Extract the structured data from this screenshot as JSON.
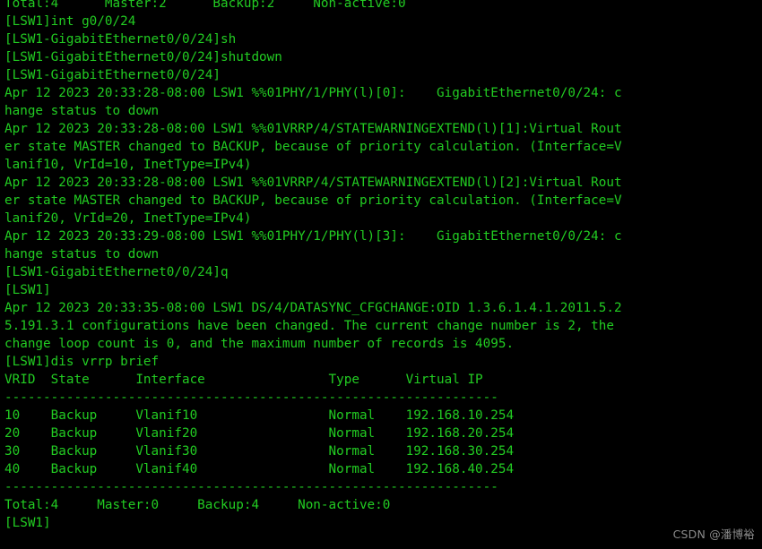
{
  "terminal": {
    "device_name": "LSW1",
    "colors": {
      "background": "#000000",
      "foreground": "#22cc22",
      "watermark": "#8a8a8a"
    },
    "lines": [
      "Total:4      Master:2      Backup:2     Non-active:0",
      "[LSW1]int g0/0/24",
      "[LSW1-GigabitEthernet0/0/24]sh",
      "[LSW1-GigabitEthernet0/0/24]shutdown",
      "[LSW1-GigabitEthernet0/0/24]",
      "Apr 12 2023 20:33:28-08:00 LSW1 %%01PHY/1/PHY(l)[0]:    GigabitEthernet0/0/24: c",
      "hange status to down",
      "Apr 12 2023 20:33:28-08:00 LSW1 %%01VRRP/4/STATEWARNINGEXTEND(l)[1]:Virtual Rout",
      "er state MASTER changed to BACKUP, because of priority calculation. (Interface=V",
      "lanif10, VrId=10, InetType=IPv4)",
      "Apr 12 2023 20:33:28-08:00 LSW1 %%01VRRP/4/STATEWARNINGEXTEND(l)[2]:Virtual Rout",
      "er state MASTER changed to BACKUP, because of priority calculation. (Interface=V",
      "lanif20, VrId=20, InetType=IPv4)",
      "Apr 12 2023 20:33:29-08:00 LSW1 %%01PHY/1/PHY(l)[3]:    GigabitEthernet0/0/24: c",
      "hange status to down",
      "[LSW1-GigabitEthernet0/0/24]q",
      "[LSW1]",
      "Apr 12 2023 20:33:35-08:00 LSW1 DS/4/DATASYNC_CFGCHANGE:OID 1.3.6.1.4.1.2011.5.2",
      "5.191.3.1 configurations have been changed. The current change number is 2, the",
      "change loop count is 0, and the maximum number of records is 4095.",
      "[LSW1]dis vrrp brief",
      "VRID  State      Interface                Type      Virtual IP",
      "----------------------------------------------------------------",
      "10    Backup     Vlanif10                 Normal    192.168.10.254",
      "20    Backup     Vlanif20                 Normal    192.168.20.254",
      "30    Backup     Vlanif30                 Normal    192.168.30.254",
      "40    Backup     Vlanif40                 Normal    192.168.40.254",
      "----------------------------------------------------------------",
      "Total:4     Master:0     Backup:4     Non-active:0",
      "[LSW1]"
    ],
    "commands_entered": [
      "int g0/0/24",
      "sh",
      "shutdown",
      "q",
      "dis vrrp brief"
    ],
    "vrrp_table": {
      "headers": [
        "VRID",
        "State",
        "Interface",
        "Type",
        "Virtual IP"
      ],
      "rows": [
        {
          "vrid": "10",
          "state": "Backup",
          "interface": "Vlanif10",
          "type": "Normal",
          "virtual_ip": "192.168.10.254"
        },
        {
          "vrid": "20",
          "state": "Backup",
          "interface": "Vlanif20",
          "type": "Normal",
          "virtual_ip": "192.168.20.254"
        },
        {
          "vrid": "30",
          "state": "Backup",
          "interface": "Vlanif30",
          "type": "Normal",
          "virtual_ip": "192.168.30.254"
        },
        {
          "vrid": "40",
          "state": "Backup",
          "interface": "Vlanif40",
          "type": "Normal",
          "virtual_ip": "192.168.40.254"
        }
      ],
      "summary_top": {
        "total": "4",
        "master": "2",
        "backup": "2",
        "non_active": "0"
      },
      "summary_bottom": {
        "total": "4",
        "master": "0",
        "backup": "4",
        "non_active": "0"
      }
    }
  },
  "watermark": {
    "text": "CSDN @潘博裕"
  }
}
